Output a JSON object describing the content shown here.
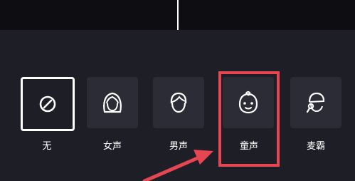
{
  "voice_effects": {
    "items": [
      {
        "label": "无",
        "icon": "none-icon",
        "selected": true
      },
      {
        "label": "女声",
        "icon": "female-voice-icon",
        "selected": false
      },
      {
        "label": "男声",
        "icon": "male-voice-icon",
        "selected": false
      },
      {
        "label": "童声",
        "icon": "child-voice-icon",
        "selected": false,
        "highlighted": true
      },
      {
        "label": "麦霸",
        "icon": "mic-singer-icon",
        "selected": false
      }
    ]
  },
  "annotation": {
    "highlight_color": "#e64552",
    "arrow_color": "#e64552"
  }
}
